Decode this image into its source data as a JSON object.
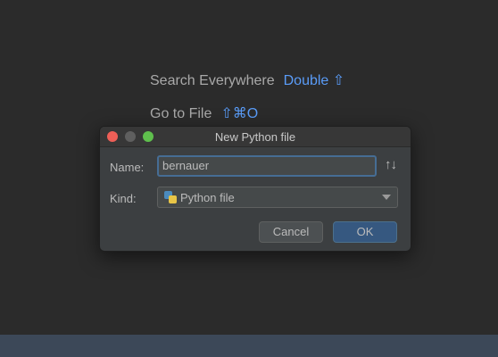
{
  "hints": {
    "search_everywhere": {
      "label": "Search Everywhere",
      "shortcut": "Double ⇧"
    },
    "go_to_file": {
      "label": "Go to File",
      "shortcut": "⇧⌘O"
    }
  },
  "dialog": {
    "title": "New Python file",
    "name_label": "Name:",
    "name_value": "bernauer",
    "kind_label": "Kind:",
    "kind_value": "Python file",
    "kind_icon": "python-file-icon",
    "sort_icon": "↑↓",
    "cancel_label": "Cancel",
    "ok_label": "OK"
  }
}
